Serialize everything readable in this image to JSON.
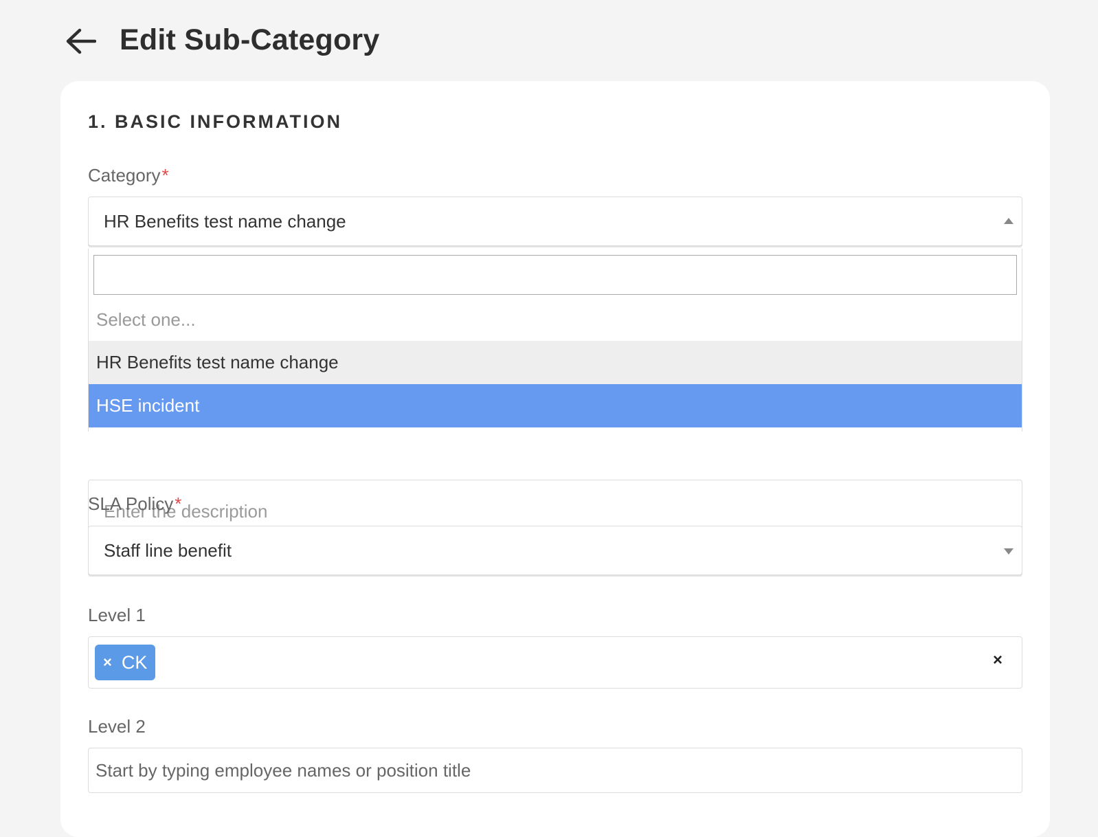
{
  "header": {
    "title": "Edit Sub-Category",
    "back_icon": "arrow-left-icon"
  },
  "section": {
    "title": "1. BASIC INFORMATION"
  },
  "category": {
    "label": "Category",
    "required_mark": "*",
    "value": "HR Benefits test name change",
    "dropdown_open": true,
    "search_value": "",
    "options": [
      {
        "label": "Select one...",
        "state": "placeholder"
      },
      {
        "label": "HR Benefits test name change",
        "state": "selected"
      },
      {
        "label": "HSE incident",
        "state": "highlighted"
      }
    ]
  },
  "description": {
    "placeholder": "Enter the description"
  },
  "sla_policy": {
    "label": "SLA Policy",
    "required_mark": "*",
    "value": "Staff line benefit"
  },
  "level1": {
    "label": "Level 1",
    "tags": [
      {
        "remove": "×",
        "text": "CK"
      }
    ],
    "clear": "×"
  },
  "level2": {
    "label": "Level 2",
    "placeholder": "Start by typing employee names or position title",
    "value": ""
  },
  "colors": {
    "highlight": "#6699f0",
    "tag": "#5b9ae6",
    "required": "#e04848",
    "background": "#f4f4f4"
  }
}
